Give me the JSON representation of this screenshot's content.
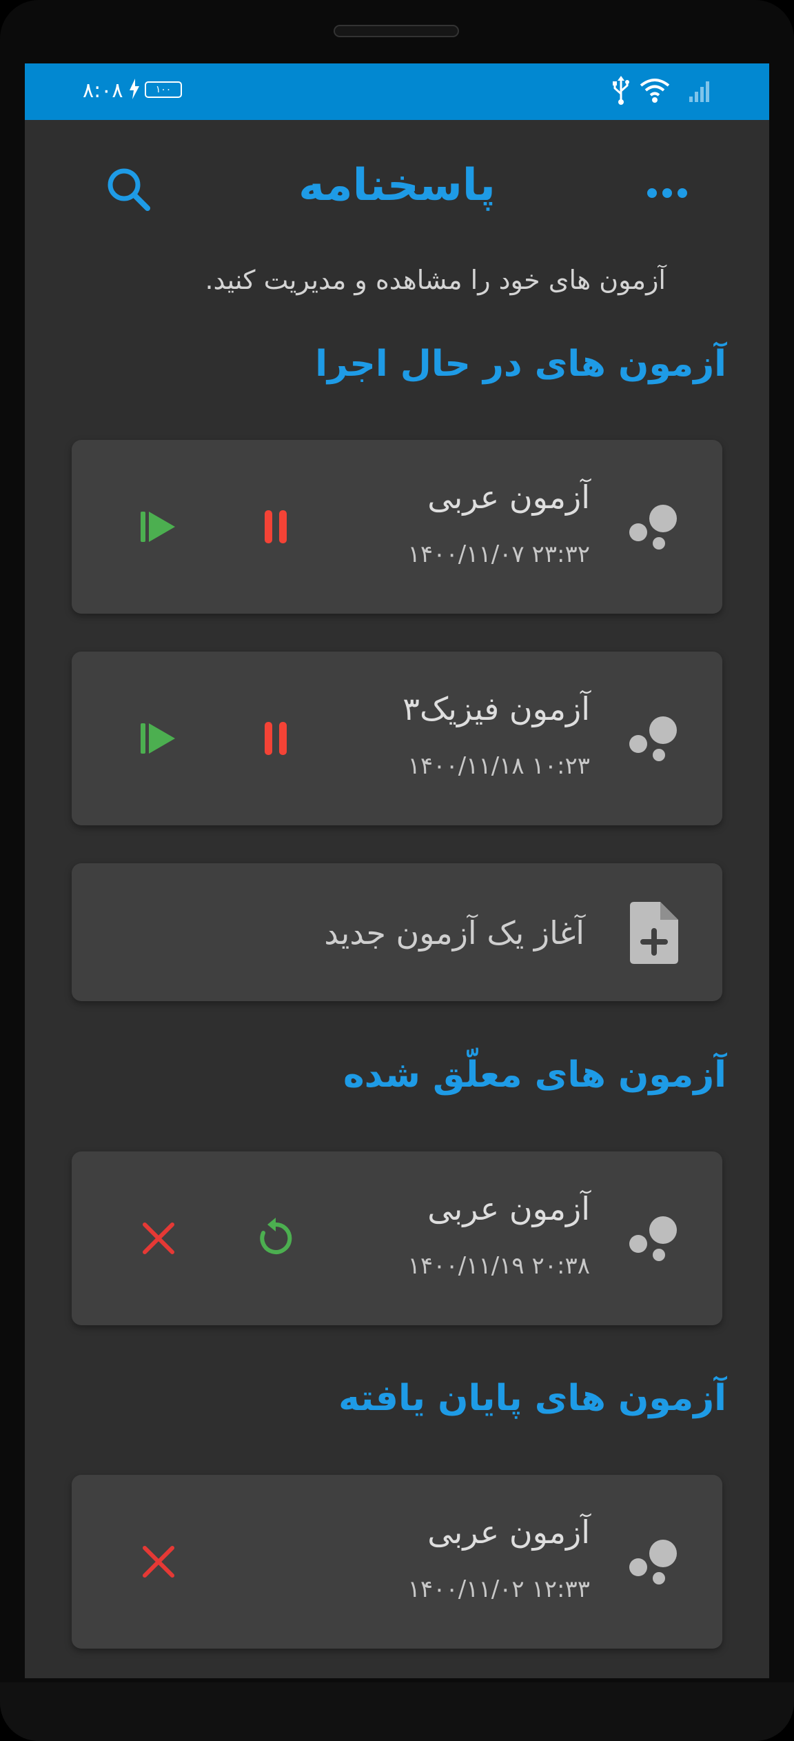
{
  "status_bar": {
    "time": "۸:۰۸",
    "battery": "۱۰۰"
  },
  "header": {
    "title": "پاسخنامه",
    "subtitle": "آزمون های خود را مشاهده و مدیریت کنید."
  },
  "sections": {
    "running": {
      "title": "آزمون های در حال اجرا",
      "items": [
        {
          "title": "آزمون عربی",
          "date": "۱۴۰۰/۱۱/۰۷ ۲۳:۳۲"
        },
        {
          "title": "آزمون فیزیک۳",
          "date": "۱۴۰۰/۱۱/۱۸ ۱۰:۲۳"
        }
      ],
      "new_exam_label": "آغاز یک آزمون جدید"
    },
    "suspended": {
      "title": "آزمون های معلّق شده",
      "items": [
        {
          "title": "آزمون عربی",
          "date": "۱۴۰۰/۱۱/۱۹ ۲۰:۳۸"
        }
      ]
    },
    "finished": {
      "title": "آزمون های پایان یافته",
      "items": [
        {
          "title": "آزمون عربی",
          "date": "۱۴۰۰/۱۱/۰۲ ۱۲:۳۳"
        }
      ]
    }
  },
  "colors": {
    "accent": "#1e9be6",
    "play": "#4caf50",
    "pause": "#f44336",
    "delete": "#e53935",
    "restore": "#4caf50",
    "card_bg": "#404040",
    "screen_bg": "#2f2f2f"
  },
  "icons": {
    "search": "search-icon",
    "more": "more-dots-icon",
    "exam": "bubbles-icon",
    "play": "play-icon",
    "pause": "pause-icon",
    "restore": "restore-icon",
    "delete": "close-icon",
    "new_file": "file-plus-icon"
  }
}
